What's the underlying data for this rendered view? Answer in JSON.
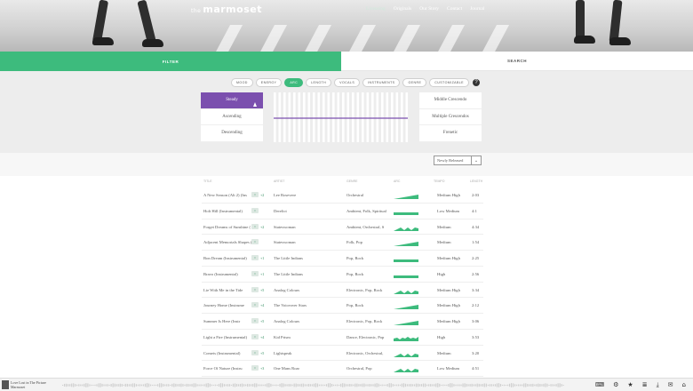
{
  "brand": {
    "logo_prefix": "the",
    "logo": "marmoset"
  },
  "nav": [
    "Licensing",
    "Originals",
    "Our Story",
    "Contact",
    "Journal"
  ],
  "tabs": {
    "filter": "FILTER",
    "search": "SEARCH"
  },
  "filter_pills": [
    {
      "label": "MOOD",
      "active": false
    },
    {
      "label": "ENERGY",
      "active": false
    },
    {
      "label": "ARC",
      "active": true
    },
    {
      "label": "LENGTH",
      "active": false
    },
    {
      "label": "VOCALS",
      "active": false
    },
    {
      "label": "INSTRUMENTS",
      "active": false
    },
    {
      "label": "GENRE",
      "active": false
    },
    {
      "label": "CUSTOMIZABLE",
      "active": false
    }
  ],
  "help_icon": "?",
  "arc_options_left": [
    {
      "label": "Steady",
      "active": true
    },
    {
      "label": "Ascending",
      "active": false
    },
    {
      "label": "Descending",
      "active": false
    }
  ],
  "arc_options_right": [
    {
      "label": "Middle Crescendo",
      "active": false
    },
    {
      "label": "Multiple Crescendos",
      "active": false
    },
    {
      "label": "Frenetic",
      "active": false
    }
  ],
  "sort": {
    "selected": "Newly Released"
  },
  "columns": {
    "title": "TITLE",
    "artist": "ARTIST",
    "genre": "GENRE",
    "arc": "ARC",
    "tempo": "TEMPO",
    "length": "LENGTH"
  },
  "accent": "#3dbb7d",
  "accent_purple": "#7b4fae",
  "tracks": [
    {
      "title": "A New Season (Alt 2) (Ins",
      "plus": "+2",
      "artist": "Lee Rosevere",
      "genre": "Orchestral",
      "tempo": "Medium High",
      "length": "2:03",
      "arc": "ascending"
    },
    {
      "title": "Holt Hill (Instrumental)",
      "plus": "",
      "artist": "Derelict",
      "genre": "Ambient, Folk, Spiritual",
      "tempo": "Low Medium",
      "length": "4:1",
      "arc": "steady"
    },
    {
      "title": "Forget Dreams of Sunshine (",
      "plus": "+2",
      "artist": "Stateswoman",
      "genre": "Ambient, Orchestral, S",
      "tempo": "Medium",
      "length": "4:34",
      "arc": "multiple"
    },
    {
      "title": "Adjacent Memorials Shapes (Instru",
      "plus": "",
      "artist": "Stateswoman",
      "genre": "Folk, Pop",
      "tempo": "Medium",
      "length": "1:54",
      "arc": "ascending"
    },
    {
      "title": "Bon Dream (Instrumental)",
      "plus": "+1",
      "artist": "The Little Indians",
      "genre": "Pop, Rock",
      "tempo": "Medium High",
      "length": "2:25",
      "arc": "steady"
    },
    {
      "title": "Bravo (Instrumental)",
      "plus": "+1",
      "artist": "The Little Indians",
      "genre": "Pop, Rock",
      "tempo": "High",
      "length": "2:56",
      "arc": "steady"
    },
    {
      "title": "Lie With Me in the Tide",
      "plus": "+5",
      "artist": "Analog Colours",
      "genre": "Electronic, Pop, Rock",
      "tempo": "Medium High",
      "length": "3:34",
      "arc": "multiple"
    },
    {
      "title": "Journey Home (Instrume",
      "plus": "+4",
      "artist": "The Voiceover Stars",
      "genre": "Pop, Rock",
      "tempo": "Medium High",
      "length": "2:12",
      "arc": "ascending"
    },
    {
      "title": "Summer Is Here (Instr",
      "plus": "+5",
      "artist": "Analog Colours",
      "genre": "Electronic, Pop, Rock",
      "tempo": "Medium High",
      "length": "3:06",
      "arc": "ascending"
    },
    {
      "title": "Light a Fire (Instrumental)",
      "plus": "+4",
      "artist": "Kid Prism",
      "genre": "Dance, Electronic, Pop",
      "tempo": "High",
      "length": "3:53",
      "arc": "frenetic"
    },
    {
      "title": "Comets (Instrumental)",
      "plus": "+5",
      "artist": "Lightspeak",
      "genre": "Electronic, Orchestral,",
      "tempo": "Medium",
      "length": "3:20",
      "arc": "multiple"
    },
    {
      "title": "Force Of Nature (Instru",
      "plus": "+3",
      "artist": "One Mans Roar",
      "genre": "Orchestral, Pop",
      "tempo": "Low Medium",
      "length": "4:51",
      "arc": "multiple"
    }
  ],
  "player": {
    "title": "Love Lost in The Picture",
    "artist": "Marmoset"
  },
  "player_icons": [
    {
      "name": "keyboard-icon",
      "glyph": "⌨"
    },
    {
      "name": "sliders-icon",
      "glyph": "⚙"
    },
    {
      "name": "star-icon",
      "glyph": "★"
    },
    {
      "name": "code-icon",
      "glyph": "≣"
    },
    {
      "name": "download-icon",
      "glyph": "⤓"
    },
    {
      "name": "chat-icon",
      "glyph": "✉"
    },
    {
      "name": "cart-icon",
      "glyph": "⌂"
    }
  ]
}
